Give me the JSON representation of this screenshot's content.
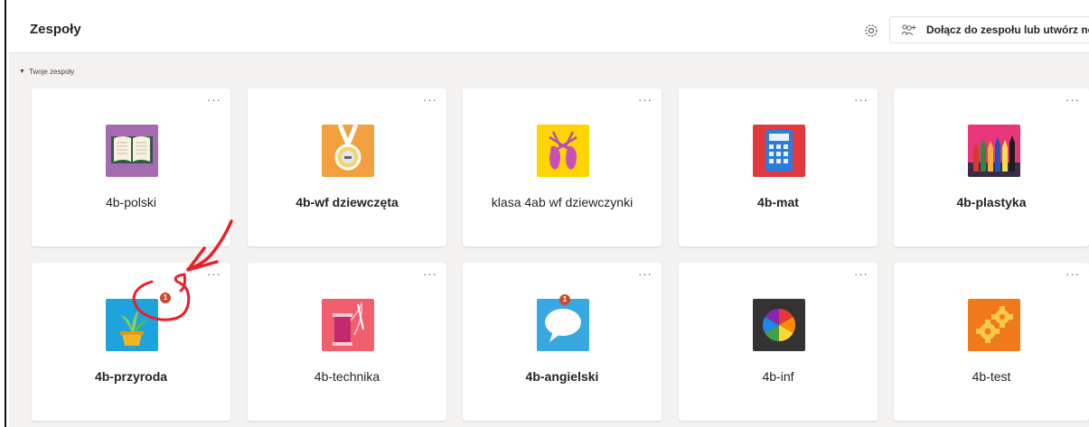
{
  "header": {
    "title": "Zespoły",
    "join_button_label": "Dołącz do zespołu lub utwórz nowy"
  },
  "section": {
    "label": "Twoje zespoły"
  },
  "teams": [
    {
      "name": "4b-polski",
      "bold": false,
      "icon": "open-book-icon",
      "badge": ""
    },
    {
      "name": "4b-wf dziewczęta",
      "bold": true,
      "icon": "medal-icon",
      "badge": ""
    },
    {
      "name": "klasa 4ab wf dziewczynki",
      "bold": false,
      "icon": "ballet-shoes-icon",
      "badge": ""
    },
    {
      "name": "4b-mat",
      "bold": true,
      "icon": "calculator-icon",
      "badge": ""
    },
    {
      "name": "4b-plastyka",
      "bold": true,
      "icon": "colored-pencils-icon",
      "badge": ""
    },
    {
      "name": "4b-przyroda",
      "bold": true,
      "icon": "plant-pot-icon",
      "badge": "1"
    },
    {
      "name": "4b-technika",
      "bold": false,
      "icon": "thread-needle-icon",
      "badge": ""
    },
    {
      "name": "4b-angielski",
      "bold": true,
      "icon": "speech-bubble-icon",
      "badge": "1"
    },
    {
      "name": "4b-inf",
      "bold": false,
      "icon": "color-wheel-icon",
      "badge": ""
    },
    {
      "name": "4b-test",
      "bold": false,
      "icon": "gears-icon",
      "badge": ""
    }
  ],
  "more_label": "···",
  "colors": {
    "accent_annotation": "#e8202a",
    "badge": "#cc4a31",
    "page_background": "#f3f2f1"
  }
}
